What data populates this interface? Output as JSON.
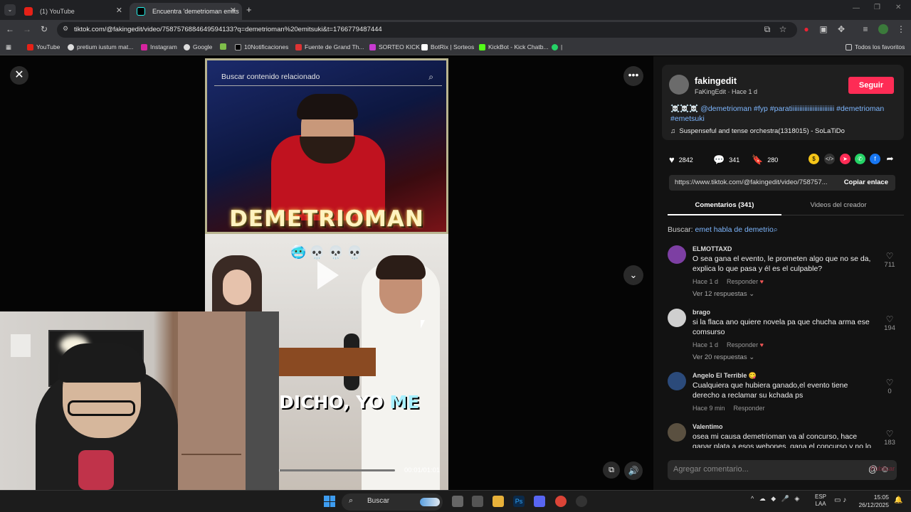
{
  "browser": {
    "tabs": [
      {
        "title": "(1) YouTube",
        "active": false
      },
      {
        "title": "Encuentra 'demetrioman emits",
        "active": true
      }
    ],
    "url": "tiktok.com/@fakingedit/video/7587576884649594133?q=demetrioman%20emitsuki&t=1766779487444",
    "bookmarks": [
      "YouTube",
      "pretium iustum mat...",
      "Instagram",
      "Google",
      "10Notificaciones",
      "Fuente de Grand Th...",
      "SORTEO KICK",
      "BotRix | Sorteos",
      "KickBot - Kick Chatb...",
      "|"
    ],
    "favorites_label": "Todos los favoritos"
  },
  "video": {
    "search_placeholder": "Buscar contenido relacionado",
    "overlay_top": "DEMETRIOMAN",
    "emojis": "🥶💀💀💀",
    "caption_prefix": "DICHO, YO",
    "caption_highlight": "ME",
    "timecode": "00:01/01:01",
    "progress_fraction": 0.016
  },
  "creator": {
    "name": "fakingedit",
    "subtitle": "FaKingEdit · Hace 1 d",
    "follow_label": "Seguir",
    "description_skulls": "☠️☠️☠️",
    "description_tags": "@demetrioman #fyp #paratiiiiiiiiiiiiiiiiiiiiiiiiii #demetrioman #emetsuki",
    "music": "Suspenseful and tense orchestra(1318015) - SoLaTiDo"
  },
  "actions": {
    "likes": "2842",
    "comments": "341",
    "saves": "280"
  },
  "link": {
    "url": "https://www.tiktok.com/@fakingedit/video/758757...",
    "copy_label": "Copiar enlace"
  },
  "panel_tabs": {
    "comments": "Comentarios (341)",
    "creator_videos": "Videos del creador"
  },
  "search_hint": {
    "prefix": "Buscar:",
    "query": "emet habla de demetrio"
  },
  "comments": [
    {
      "user": "ELMOTTAXD",
      "text": "O sea gana el evento, le prometen algo que no se da, explica lo que pasa y él es el culpable?",
      "time": "Hace 1 d",
      "reply": "Responder",
      "replies": "Ver 12 respuestas",
      "likes": "711"
    },
    {
      "user": "brago",
      "text": "si la flaca ano quiere novela pa que chucha arma ese comsurso",
      "time": "Hace 1 d",
      "reply": "Responder",
      "replies": "Ver 20 respuestas",
      "likes": "194"
    },
    {
      "user": "Angelo El Terrible",
      "text": "Cualquiera que hubiera ganado,el evento tiene derecho a reclamar su kchada ps",
      "time": "Hace 9 min",
      "reply": "Responder",
      "replies": "",
      "likes": "0"
    },
    {
      "user": "Valentimo",
      "text": "osea mi causa demetrioman va al concurso, hace ganar plata a esos webones, gana el concurso y no lo",
      "time": "",
      "reply": "",
      "replies": "",
      "likes": "183"
    }
  ],
  "comment_input": {
    "placeholder": "Agregar comentario...",
    "publish_label": "Publicar"
  },
  "taskbar": {
    "search_label": "Buscar",
    "lang_line1": "ESP",
    "lang_line2": "LAA",
    "time": "15:05",
    "date": "26/12/2025"
  },
  "colors": {
    "accent": "#fe2c55",
    "link": "#7eb7ff",
    "panel_bg": "#121212"
  }
}
